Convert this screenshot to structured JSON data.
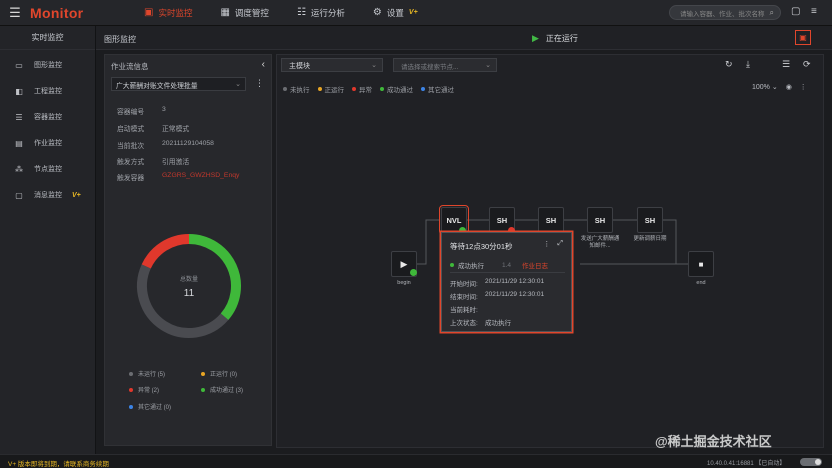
{
  "app": {
    "brand": "Monitor",
    "menu_icon": "hamburger-icon"
  },
  "topnav": [
    {
      "label": "实时监控",
      "icon": "monitor-icon",
      "active": true
    },
    {
      "label": "调度管控",
      "icon": "calendar-icon",
      "active": false
    },
    {
      "label": "运行分析",
      "icon": "sliders-icon",
      "active": false
    },
    {
      "label": "设置",
      "icon": "gear-icon",
      "active": false,
      "badge": "V+"
    }
  ],
  "search": {
    "placeholder": "请输入容器、作业、批次名称"
  },
  "sidebar": {
    "title": "实时监控",
    "items": [
      {
        "label": "图形监控",
        "icon": "monitor-graph-icon"
      },
      {
        "label": "工程监控",
        "icon": "project-icon"
      },
      {
        "label": "容器监控",
        "icon": "container-icon"
      },
      {
        "label": "作业监控",
        "icon": "job-icon"
      },
      {
        "label": "节点监控",
        "icon": "node-icon"
      },
      {
        "label": "消息监控",
        "icon": "message-icon",
        "badge": "V+"
      }
    ]
  },
  "content_head": {
    "title": "图形监控",
    "status": "正在运行"
  },
  "left_panel": {
    "title": "作业流信息",
    "selected_flow": "广大薪酬对账文件处理批量",
    "info": [
      {
        "key": "容器编号",
        "value": "3"
      },
      {
        "key": "启动模式",
        "value": "正常模式"
      },
      {
        "key": "当前批次",
        "value": "20211129104058"
      },
      {
        "key": "触发方式",
        "value": "引用激活"
      },
      {
        "key": "触发容器",
        "value": "GZGRS_GWZHSD_Enqy"
      }
    ],
    "donut": {
      "label": "总数量",
      "total": "11",
      "segments": [
        {
          "name": "成功通过",
          "value": 4,
          "color": "#3fb83a"
        },
        {
          "name": "未运行",
          "value": 5,
          "color": "#4a4b50"
        },
        {
          "name": "异常",
          "value": 2,
          "color": "#e0382c"
        }
      ]
    },
    "legend": [
      {
        "label": "未运行 (5)",
        "color": "#6b6d72"
      },
      {
        "label": "正运行 (0)",
        "color": "#e8a524"
      },
      {
        "label": "异常 (2)",
        "color": "#e0382c"
      },
      {
        "label": "成功通过 (3)",
        "color": "#3fb83a"
      },
      {
        "label": "其它通过 (0)",
        "color": "#3c84e6"
      }
    ]
  },
  "canvas": {
    "module_select": "主模块",
    "node_search_placeholder": "请选择或搜索节点...",
    "status_legend": [
      {
        "label": "未执行",
        "color": "#6b6d72"
      },
      {
        "label": "正运行",
        "color": "#e8a524"
      },
      {
        "label": "异常",
        "color": "#e0382c"
      },
      {
        "label": "成功通过",
        "color": "#3fb83a"
      },
      {
        "label": "其它通过",
        "color": "#3c84e6"
      }
    ],
    "zoom": "100%",
    "nodes": {
      "begin": "begin",
      "end": "end",
      "nvl": "NVL",
      "sh1": "SH",
      "sh2": "SH",
      "sh3": "SH",
      "sh3_label": "发送广大薪酬通知邮件...",
      "sh4": "SH",
      "sh4_label": "更新调薪日期"
    }
  },
  "popover": {
    "title": "等待12点30分01秒",
    "status": "成功执行",
    "status_extra": "1.4",
    "link": "作业日志",
    "start_key": "开始时间:",
    "start_value": "2021/11/29 12:30:01",
    "end_key": "结束时间:",
    "end_value": "2021/11/29 12:30:01",
    "cur_key": "当前耗时:",
    "cur_value": "",
    "last_key": "上次状态:",
    "last_value": "成功执行"
  },
  "footer": {
    "left": "V+ 版本即将到期，请联系商务续期",
    "right": "10.40.0.41:16881  【已自动】"
  },
  "watermark": "@稀土掘金技术社区"
}
